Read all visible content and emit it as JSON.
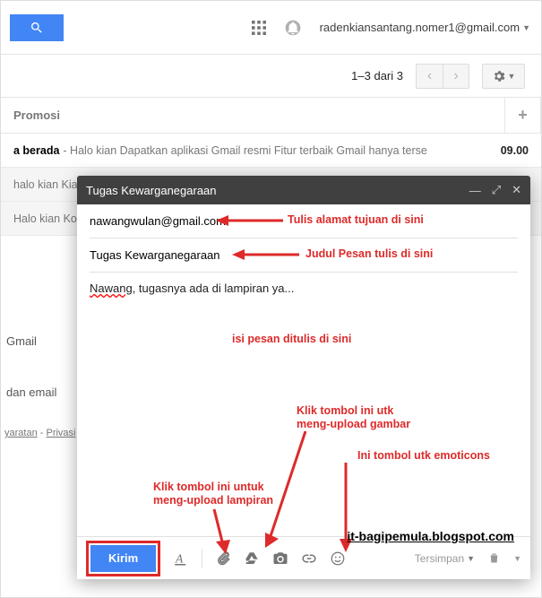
{
  "header": {
    "user_email": "radenkiansantang.nomer1@gmail.com"
  },
  "subheader": {
    "count_label": "1–3 dari 3"
  },
  "tabs": {
    "promo": "Promosi"
  },
  "mails": [
    {
      "subject": "a berada",
      "fragment": " - Halo kian Dapatkan aplikasi Gmail resmi Fitur terbaik Gmail hanya terse",
      "time": "09.00",
      "unread": true
    },
    {
      "subject": "",
      "fragment": "halo kian Kiat un",
      "time": "",
      "unread": false
    },
    {
      "subject": "",
      "fragment": "Halo kian Kota",
      "time": "",
      "unread": false
    }
  ],
  "sidebar": {
    "item1": "Gmail",
    "item2": "dan email",
    "footer_a": "yaratan",
    "footer_b": "Privasi"
  },
  "compose": {
    "title": "Tugas Kewarganegaraan",
    "to_value": "nawangwulan@gmail.com",
    "subject_value": "Tugas Kewarganegaraan",
    "body_prefix": "Nawang",
    "body_rest": ", tugasnya ada di lampiran ya...",
    "send_label": "Kirim",
    "saved_label": "Tersimpan"
  },
  "annotations": {
    "to": "Tulis alamat tujuan di sini",
    "subject": "Judul Pesan tulis di sini",
    "body": "isi pesan ditulis di sini",
    "photo": "Klik tombol ini utk\nmeng-upload gambar",
    "emoticon": "Ini tombol utk emoticons",
    "attachment": "Klik tombol ini untuk\nmeng-upload lampiran"
  },
  "watermark": "it-bagipemula.blogspot.com"
}
